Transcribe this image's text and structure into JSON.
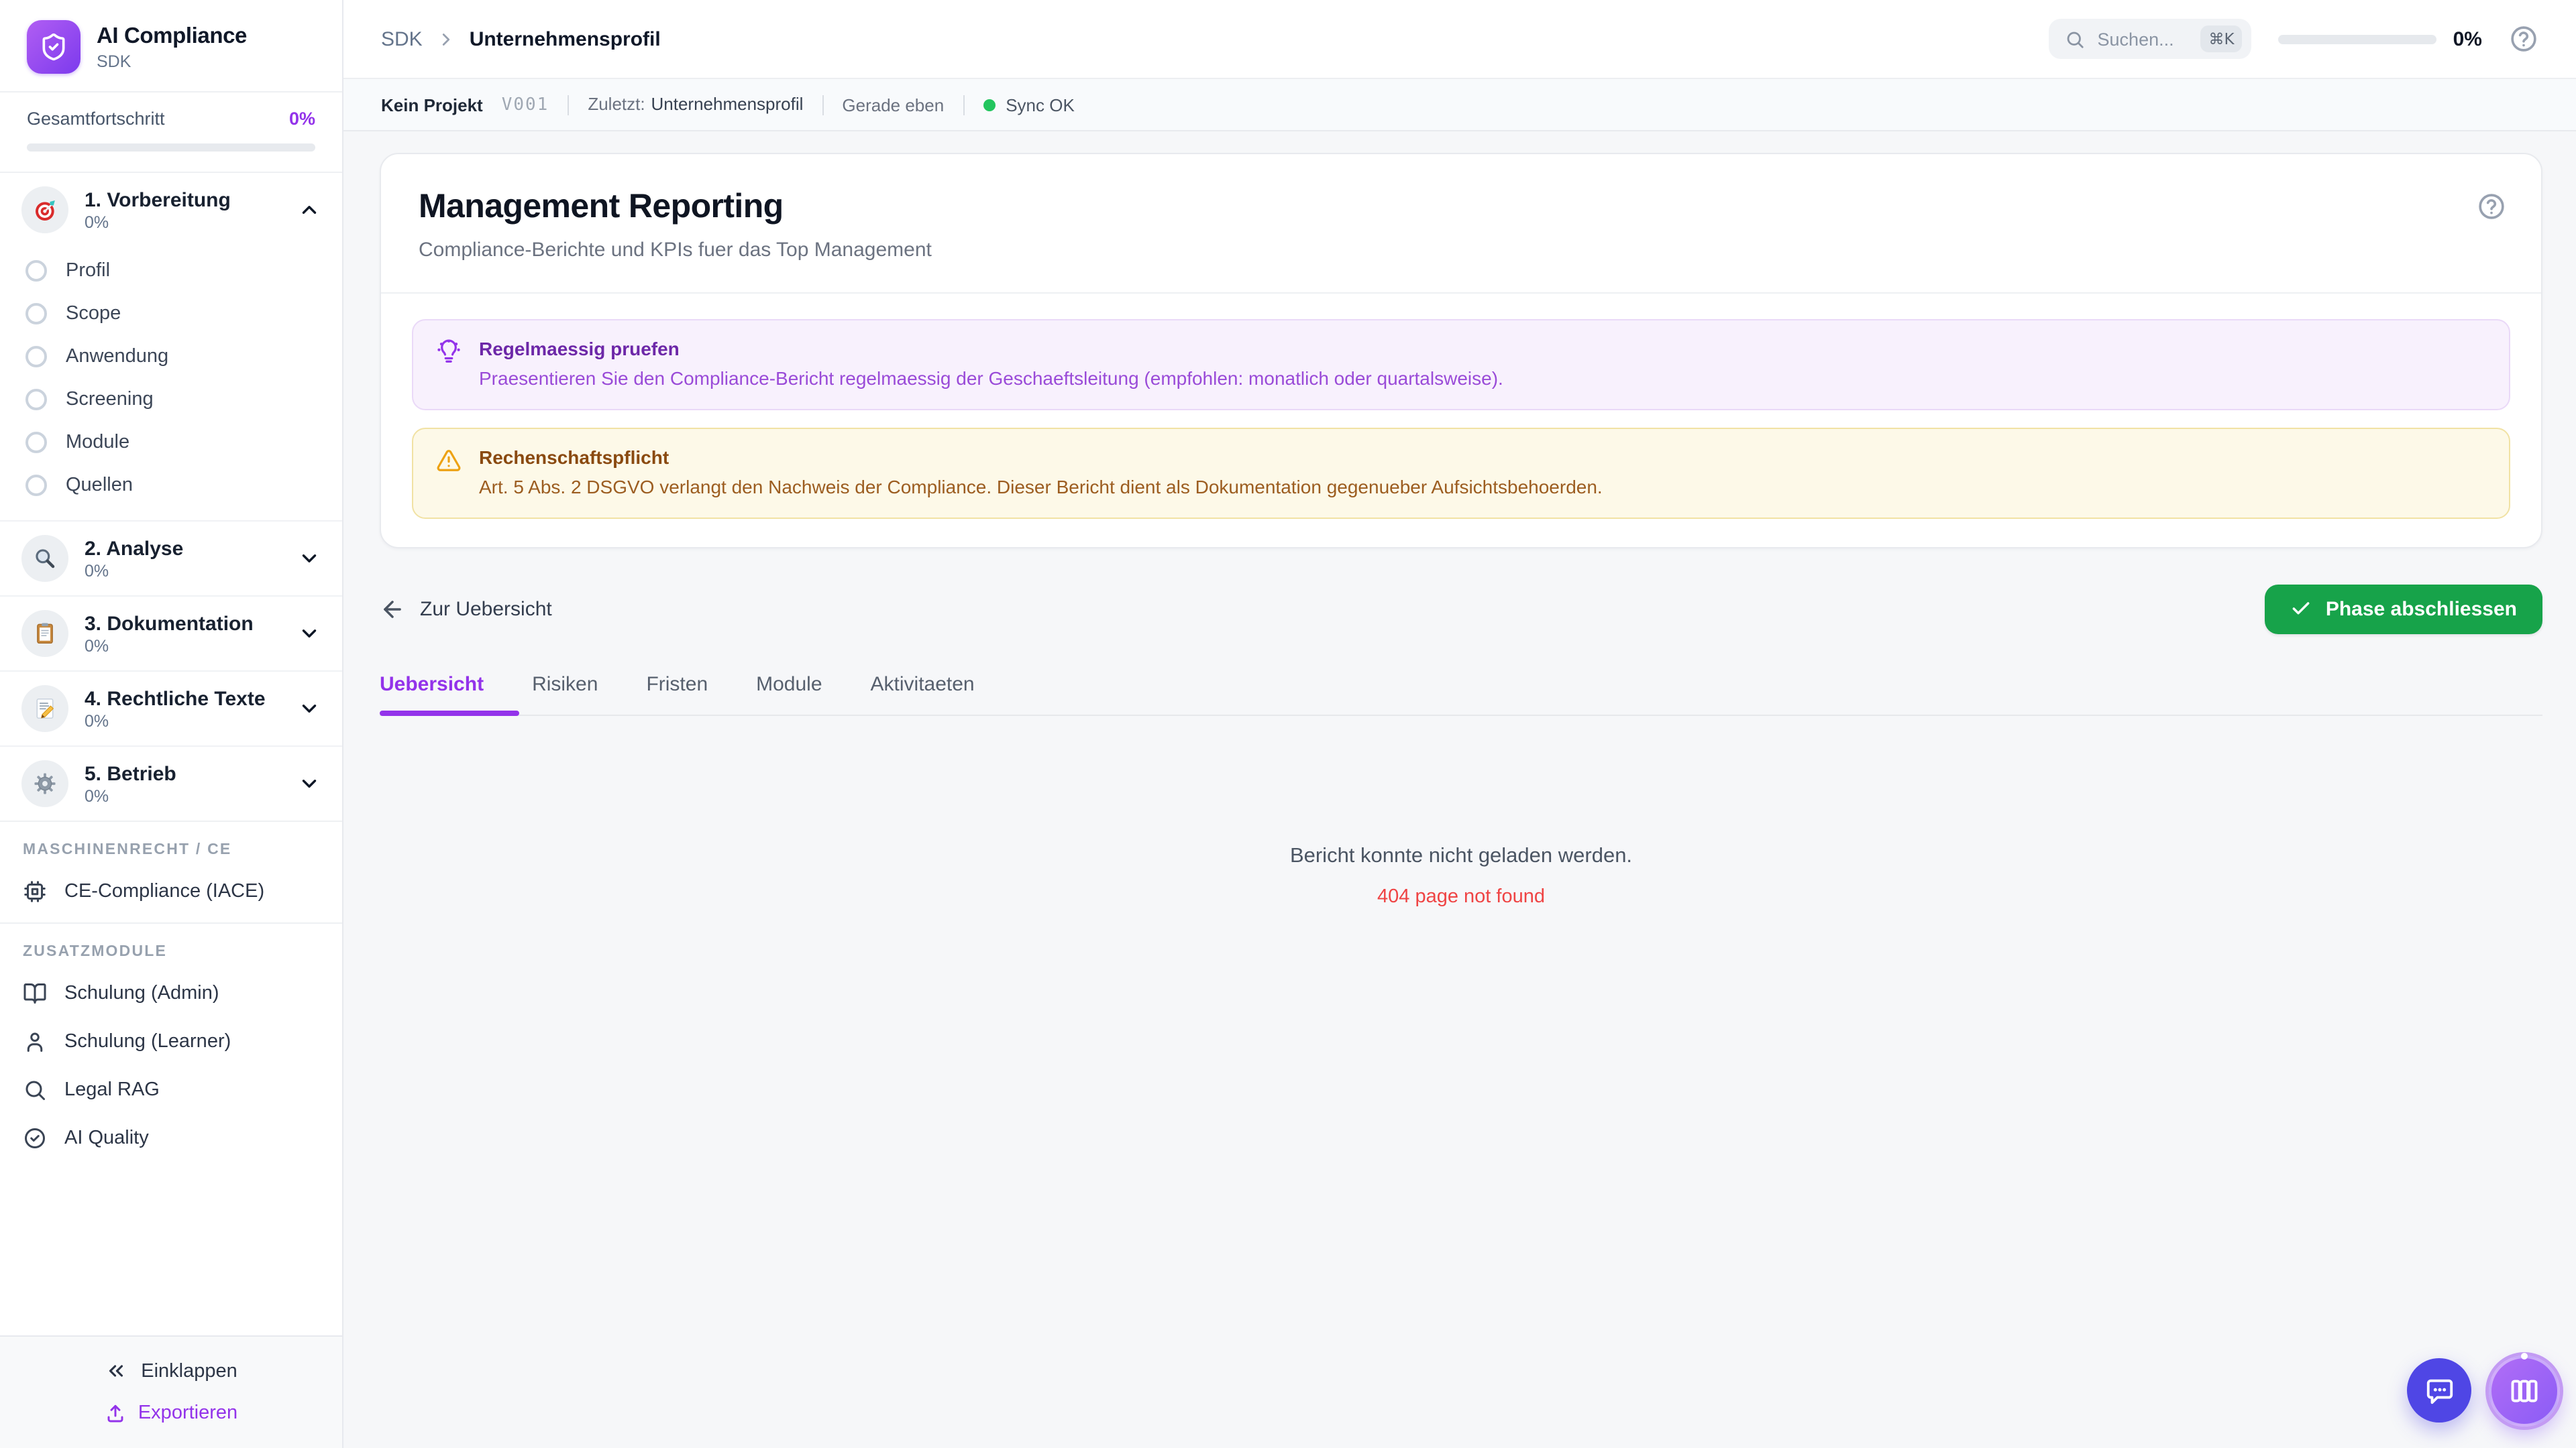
{
  "app": {
    "name": "AI Compliance",
    "variant": "SDK",
    "logo_icon": "shield-check-icon"
  },
  "sidebar": {
    "progress": {
      "label": "Gesamtfortschritt",
      "value": "0%"
    },
    "sections": [
      {
        "icon": "target-icon",
        "title": "1. Vorbereitung",
        "percent": "0%",
        "state": "expanded",
        "items": [
          {
            "label": "Profil"
          },
          {
            "label": "Scope"
          },
          {
            "label": "Anwendung"
          },
          {
            "label": "Screening"
          },
          {
            "label": "Module"
          },
          {
            "label": "Quellen"
          }
        ]
      },
      {
        "icon": "magnifier-icon",
        "title": "2. Analyse",
        "percent": "0%",
        "state": "collapsed"
      },
      {
        "icon": "clipboard-icon",
        "title": "3. Dokumentation",
        "percent": "0%",
        "state": "collapsed"
      },
      {
        "icon": "memo-pencil-icon",
        "title": "4. Rechtliche Texte",
        "percent": "0%",
        "state": "collapsed"
      },
      {
        "icon": "gear-icon",
        "title": "5. Betrieb",
        "percent": "0%",
        "state": "collapsed"
      }
    ],
    "groups": [
      {
        "label": "MASCHINENRECHT / CE",
        "items": [
          {
            "icon": "chip-icon",
            "label": "CE-Compliance (IACE)"
          }
        ]
      },
      {
        "label": "ZUSATZMODULE",
        "items": [
          {
            "icon": "book-open-icon",
            "label": "Schulung (Admin)"
          },
          {
            "icon": "user-icon",
            "label": "Schulung (Learner)"
          },
          {
            "icon": "search-icon",
            "label": "Legal RAG"
          },
          {
            "icon": "check-circle-icon",
            "label": "AI Quality"
          }
        ]
      }
    ],
    "footer": {
      "collapse": "Einklappen",
      "export": "Exportieren"
    }
  },
  "topbar": {
    "breadcrumb": {
      "root": "SDK",
      "current": "Unternehmensprofil"
    },
    "search": {
      "placeholder": "Suchen...",
      "shortcut": "⌘K"
    },
    "progress": {
      "value": "0%"
    }
  },
  "statusbar": {
    "project": "Kein Projekt",
    "version": "V001",
    "last_label": "Zuletzt:",
    "last_value": "Unternehmensprofil",
    "time": "Gerade eben",
    "sync": "Sync OK"
  },
  "page": {
    "title": "Management Reporting",
    "subtitle": "Compliance-Berichte und KPIs fuer das Top Management"
  },
  "callouts": [
    {
      "type": "tip",
      "icon": "lightbulb-icon",
      "title": "Regelmaessig pruefen",
      "body": "Praesentieren Sie den Compliance-Bericht regelmaessig der Geschaeftsleitung (empfohlen: monatlich oder quartalsweise)."
    },
    {
      "type": "warning",
      "icon": "warning-triangle-icon",
      "title": "Rechenschaftspflicht",
      "body": "Art. 5 Abs. 2 DSGVO verlangt den Nachweis der Compliance. Dieser Bericht dient als Dokumentation gegenueber Aufsichtsbehoerden."
    }
  ],
  "actions": {
    "back": "Zur Uebersicht",
    "complete": "Phase abschliessen"
  },
  "tabs": {
    "active": "Uebersicht",
    "items": [
      {
        "label": "Uebersicht"
      },
      {
        "label": "Risiken"
      },
      {
        "label": "Fristen"
      },
      {
        "label": "Module"
      },
      {
        "label": "Aktivitaeten"
      }
    ]
  },
  "empty_state": {
    "message": "Bericht konnte nicht geladen werden.",
    "error": "404 page not found"
  },
  "colors": {
    "accent": "#9333ea",
    "success_button": "#17a34a",
    "sync_ok_dot": "#22c55e",
    "error_text": "#ef4444",
    "fab_chat": "#4f46e5",
    "fab_panel_start": "#b16df6",
    "fab_panel_end": "#8b5cf6"
  }
}
